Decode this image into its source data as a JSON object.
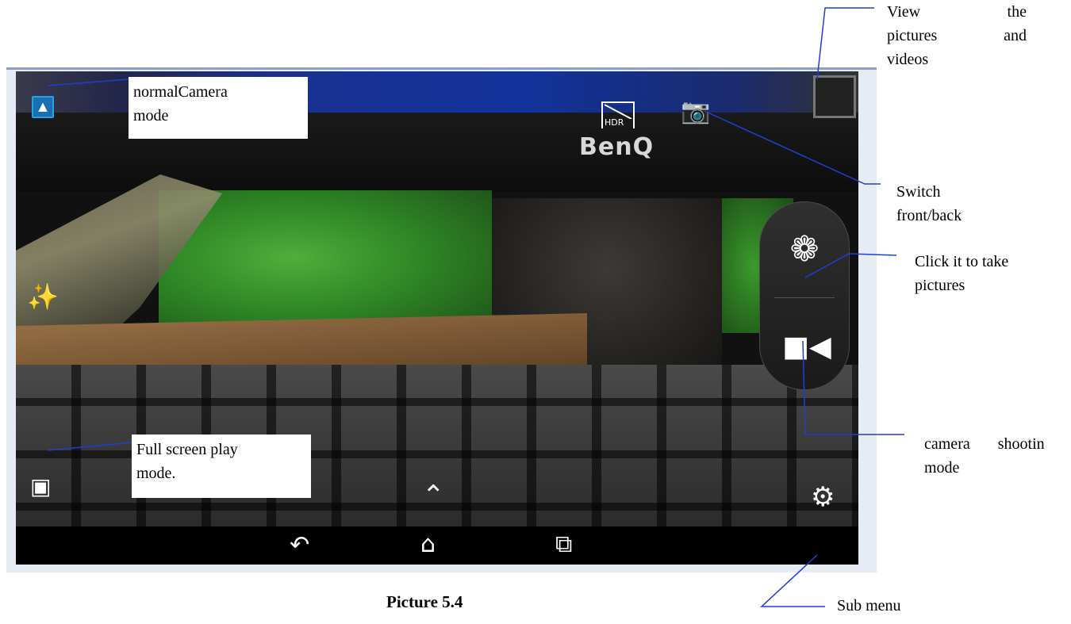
{
  "caption": "Picture 5.4",
  "callouts": {
    "normal_camera_mode": [
      "normalCamera",
      "mode"
    ],
    "view_pictures": [
      "View the",
      "pictures and",
      "videos"
    ],
    "switch_front_back": [
      "Switch",
      "front/back"
    ],
    "take_pictures": [
      "Click it to take",
      "pictures"
    ],
    "full_screen": [
      "Full screen play",
      "mode."
    ],
    "camera_shooting": [
      "camera shootin",
      "mode"
    ],
    "sub_menu": "Sub menu"
  },
  "screen": {
    "monitor_brand": "BenQ",
    "hdr_label": "HDR"
  },
  "icons": {
    "mode": "camera-mode-icon",
    "hdr": "hdr-icon",
    "switch": "switch-camera-icon",
    "thumbnail": "gallery-thumbnail",
    "effects": "effects-icon",
    "panorama": "panorama-icon",
    "expand": "chevron-up-icon",
    "settings": "gear-icon",
    "shutter": "shutter-icon",
    "video": "video-camera-icon",
    "nav_back": "back-icon",
    "nav_home": "home-icon",
    "nav_recent": "recent-apps-icon"
  },
  "colors": {
    "frame": "#e6ebf4",
    "leader_lines": "#1f3fd0",
    "mode_icon": "#2aa0e8"
  }
}
